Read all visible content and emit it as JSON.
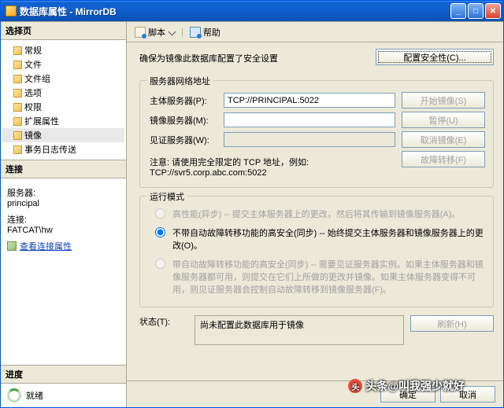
{
  "title": "数据库属性 - MirrorDB",
  "sidebar": {
    "select_header": "选择页",
    "items": [
      "常规",
      "文件",
      "文件组",
      "选项",
      "权限",
      "扩展属性",
      "镜像",
      "事务日志传送"
    ],
    "conn_header": "连接",
    "server_label": "服务器:",
    "server_value": "principal",
    "conn_label": "连接:",
    "conn_value": "FATCAT\\hw",
    "view_conn": "查看连接属性",
    "progress_header": "进度",
    "progress_value": "就绪"
  },
  "toolbar": {
    "script": "脚本",
    "help": "帮助"
  },
  "page": {
    "info": "确保为镜像此数据库配置了安全设置",
    "config_btn": "配置安全性(C)...",
    "net_group": "服务器网络地址",
    "principal_label": "主体服务器(P):",
    "principal_value": "TCP://PRINCIPAL:5022",
    "mirror_label": "镜像服务器(M):",
    "witness_label": "见证服务器(W):",
    "start_btn": "开始镜像(S)",
    "pause_btn": "暂停(U)",
    "stop_btn": "取消镜像(E)",
    "failover_btn": "故障转移(F)",
    "note": "注意: 请使用完全限定的 TCP 地址，例如: TCP://svr5.corp.abc.com:5022",
    "mode_group": "运行模式",
    "mode1": "高性能(异步) -- 提交主体服务器上的更改，然后将其传输到镜像服务器(A)。",
    "mode2": "不带自动故障转移功能的高安全(同步) -- 始终提交主体服务器和镜像服务器上的更改(O)。",
    "mode3": "带自动故障转移功能的高安全(同步) -- 需要见证服务器实例。如果主体服务器和镜像服务器都可用，则提交在它们上所做的更改并镜像。如果主体服务器变得不可用，则见证服务器会控制自动故障转移到镜像服务器(F)。",
    "status_label": "状态(T):",
    "status_value": "尚未配置此数据库用于镜像",
    "refresh_btn": "刷新(H)"
  },
  "footer": {
    "ok": "确定",
    "cancel": "取消"
  },
  "watermark": "头条@叫我强少就好"
}
